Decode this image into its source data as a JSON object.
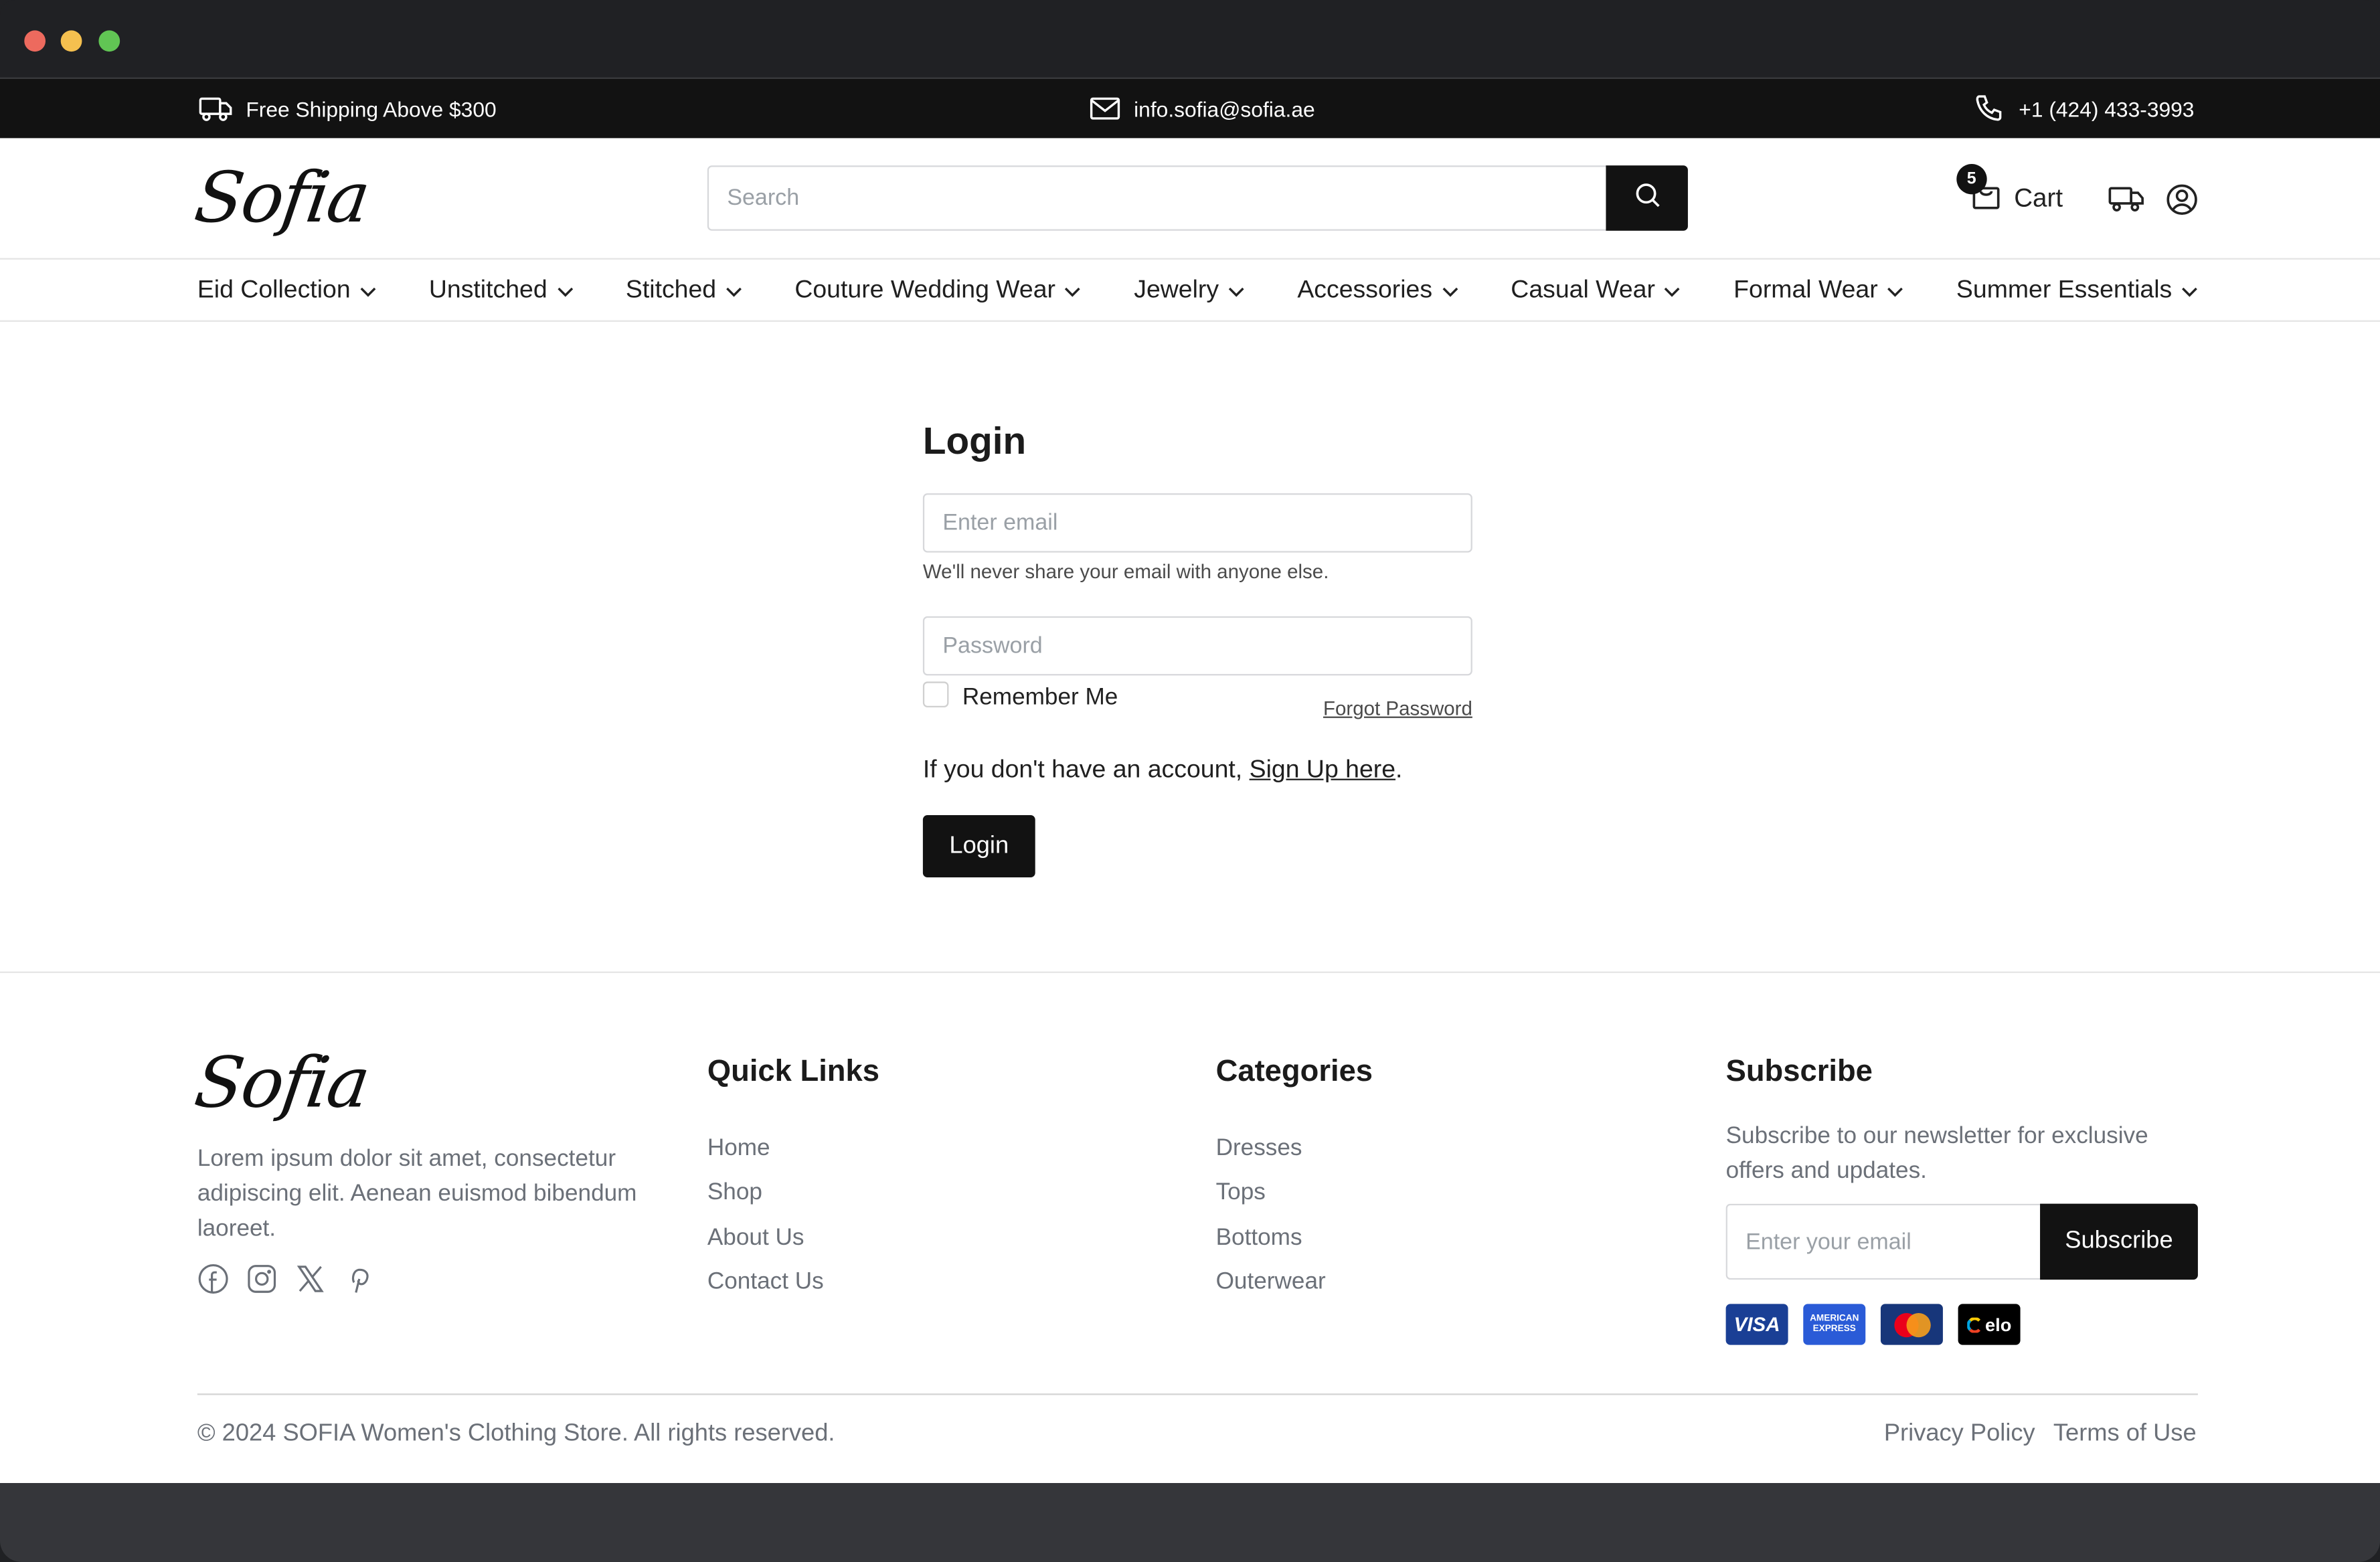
{
  "window": {
    "controls": [
      "close",
      "minimize",
      "maximize"
    ]
  },
  "infobar": {
    "shipping": {
      "icon": "truck-icon",
      "text": "Free Shipping Above $300"
    },
    "email": {
      "icon": "mail-icon",
      "text": "info.sofia@sofia.ae"
    },
    "phone": {
      "icon": "phone-icon",
      "text": "+1 (424) 433-3993"
    }
  },
  "header": {
    "logo": "Sofia",
    "search": {
      "placeholder": "Search",
      "value": "",
      "button_icon": "search-icon"
    },
    "cart": {
      "label": "Cart",
      "count": "5",
      "icon": "shopping-bag-icon"
    },
    "icons": [
      "truck-icon",
      "user-circle-icon"
    ]
  },
  "nav": {
    "items": [
      {
        "label": "Eid Collection"
      },
      {
        "label": "Unstitched"
      },
      {
        "label": "Stitched"
      },
      {
        "label": "Couture Wedding Wear"
      },
      {
        "label": "Jewelry"
      },
      {
        "label": "Accessories"
      },
      {
        "label": "Casual Wear"
      },
      {
        "label": "Formal Wear"
      },
      {
        "label": "Summer Essentials"
      }
    ]
  },
  "login": {
    "title": "Login",
    "email_placeholder": "Enter email",
    "email_help": "We'll never share your email with anyone else.",
    "password_placeholder": "Password",
    "remember_label": "Remember Me",
    "remember_checked": false,
    "forgot_label": "Forgot Password",
    "signup_prefix": "If you don't have an account, ",
    "signup_link": "Sign Up here",
    "signup_suffix": ".",
    "submit_label": "Login"
  },
  "footer": {
    "logo": "Sofia",
    "about": "Lorem ipsum dolor sit amet, consectetur adipiscing elit. Aenean euismod bibendum laoreet.",
    "social": [
      "facebook-icon",
      "instagram-icon",
      "x-icon",
      "pinterest-icon"
    ],
    "quick_links": {
      "title": "Quick Links",
      "items": [
        "Home",
        "Shop",
        "About Us",
        "Contact Us"
      ]
    },
    "categories": {
      "title": "Categories",
      "items": [
        "Dresses",
        "Tops",
        "Bottoms",
        "Outerwear"
      ]
    },
    "subscribe": {
      "title": "Subscribe",
      "text": "Subscribe to our newsletter for exclusive offers and updates.",
      "placeholder": "Enter your email",
      "button": "Subscribe"
    },
    "payment_cards": [
      {
        "name": "Visa",
        "label": "VISA",
        "color": "#1a3f95"
      },
      {
        "name": "American Express",
        "label": "AMERICAN EXPRESS",
        "color": "#2a5bd7"
      },
      {
        "name": "MasterCard",
        "label": "MasterCard",
        "color": "#17367a"
      },
      {
        "name": "Elo",
        "label": "elo",
        "color": "#000000"
      }
    ],
    "copyright": "© 2024 SOFIA Women's Clothing Store. All rights reserved.",
    "legal": [
      "Privacy Policy",
      "Terms of Use"
    ]
  },
  "colors": {
    "primary": "#121212",
    "muted_text": "#6b7078",
    "titlebar": "#202124",
    "bottombar": "#35363a"
  }
}
